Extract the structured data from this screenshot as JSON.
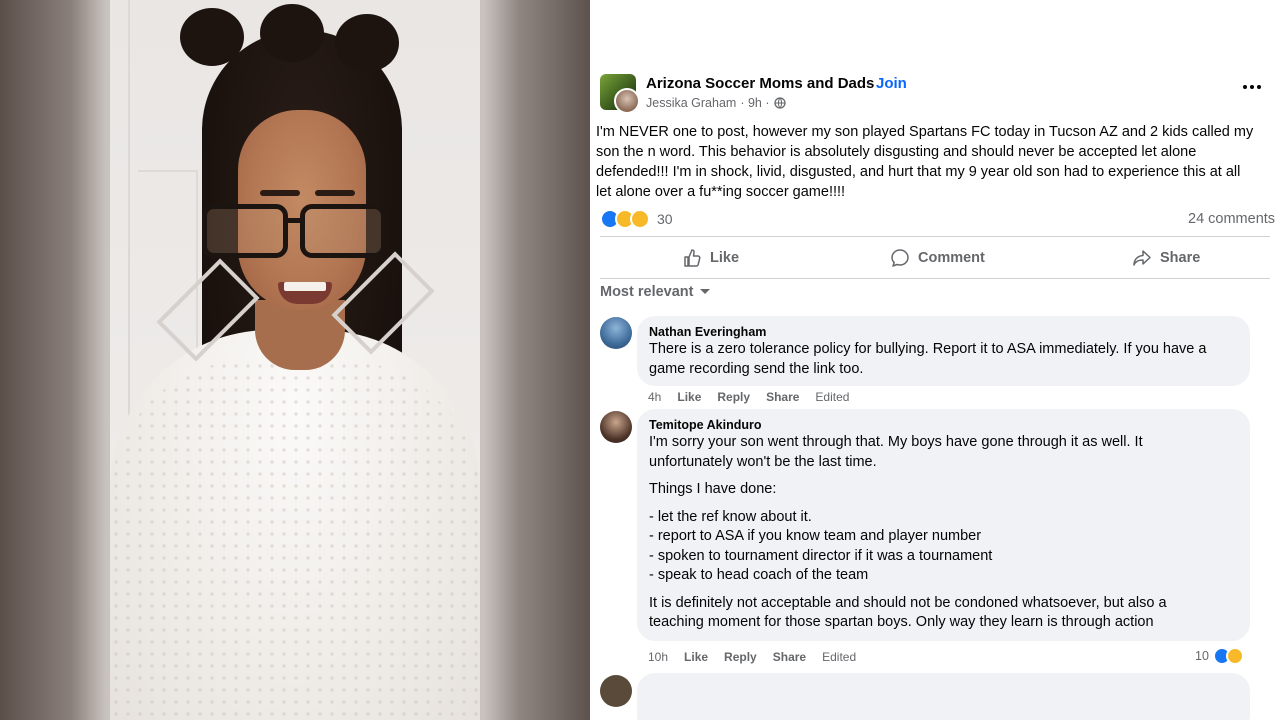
{
  "post": {
    "group_name": "Arizona Soccer Moms and Dads",
    "separator": "·",
    "join_label": "Join",
    "author": "Jessika Graham",
    "time": "· 9h ·",
    "text": "I'm NEVER one to post, however my son played Spartans FC today in Tucson AZ and 2 kids called my\nson the n word. This behavior is absolutely disgusting and should never be accepted let alone\ndefended!!! I'm in shock, livid, disgusted, and hurt that my 9 year old son had to experience this at all\nlet alone over a fu**ing soccer game!!!!",
    "reaction_count": "30",
    "reaction_icons": [
      "like-icon",
      "wow-icon",
      "sad-icon"
    ],
    "comment_count": "24 comments",
    "actions": {
      "like": "Like",
      "comment": "Comment",
      "share": "Share"
    },
    "sort_label": "Most relevant"
  },
  "comments": [
    {
      "name": "Nathan Everingham",
      "text": "There is a zero tolerance policy for bullying. Report it to ASA immediately. If you have a\ngame recording send the link too.",
      "time": "4h",
      "like": "Like",
      "reply": "Reply",
      "share": "Share",
      "edited": "Edited"
    },
    {
      "name": "Temitope Akinduro",
      "para1": "I'm sorry your son went through that. My boys have gone through it as well. It\nunfortunately won't be the last time.",
      "para2": "Things I have done:",
      "para3": "- let the ref know about it.\n- report to ASA if you know team and player number\n- spoken to tournament director if it was a tournament\n- speak to head coach of the team",
      "para4": "It is definitely not acceptable and should not be condoned whatsoever, but also a\nteaching moment for those spartan boys. Only way they learn is through action",
      "time": "10h",
      "like": "Like",
      "reply": "Reply",
      "share": "Share",
      "edited": "Edited",
      "reaction_count": "10",
      "reaction_icons": [
        "like-icon",
        "care-icon"
      ]
    }
  ],
  "colors": {
    "accent": "#0866ff",
    "muted": "#65676b",
    "bubble": "#f0f2f5",
    "divider": "#ced0d4"
  }
}
